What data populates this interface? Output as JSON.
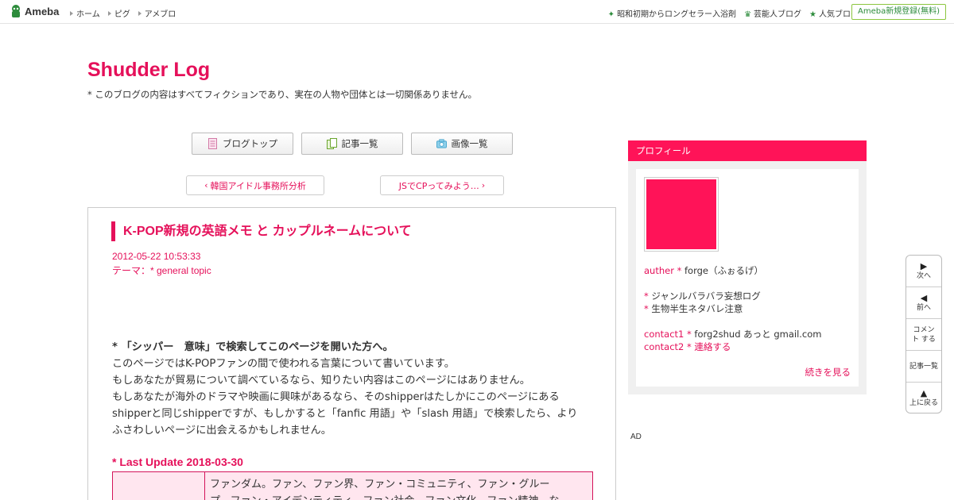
{
  "topbar": {
    "logo_text": "Ameba",
    "nav": [
      "ホーム",
      "ピグ",
      "アメブロ"
    ],
    "right_links": [
      {
        "icon": "sparkle-icon",
        "label": "昭和初期からロングセラー入浴剤"
      },
      {
        "icon": "crown-icon",
        "label": "芸能人ブログ"
      },
      {
        "icon": "star-icon",
        "label": "人気ブログ"
      }
    ],
    "register_label": "Ameba新規登録(無料)"
  },
  "header": {
    "title": "Shudder Log",
    "description": "* このブログの内容はすべてフィクションであり、実在の人物や団体とは一切関係ありません。"
  },
  "blog_nav": {
    "top_label": "ブログトップ",
    "list_label": "記事一覧",
    "images_label": "画像一覧"
  },
  "pager": {
    "prev_label": "韓国アイドル事務所分析",
    "next_label": "JSでCPってみよう…"
  },
  "article": {
    "title": "K-POP新規の英語メモ と カップルネームについて",
    "date": "2012-05-22 10:53:33",
    "theme": "テーマ：* general topic",
    "lead": "* 「シッパー　意味」で検索してこのページを開いた方へ。",
    "lines": [
      "このページではK-POPファンの間で使われる言葉について書いています。",
      "もしあなたが貿易について調べているなら、知りたい内容はこのページにはありません。",
      "もしあなたが海外のドラマや映画に興味があるなら、そのshipperはたしかにこのページにある",
      "shipperと同じshipperですが、もしかすると「fanfic 用語」や「slash 用語」で検索したら、より",
      "ふさわしいページに出会えるかもしれません。"
    ],
    "last_update": "* Last Update 2018-03-30",
    "table_text_1": "ファンダム。ファン、ファン界、ファン・コミュニティ、ファン・グルー",
    "table_text_2": "プ、ファン・アイデンティティ、ファン社会、ファン文化、ファン精神、な"
  },
  "profile": {
    "header": "プロフィール",
    "auther_key": "auther * ",
    "auther_val": "forge（ふぉるげ）",
    "line1_mark": "* ",
    "line1": "ジャンルバラバラ妄想ログ",
    "line2_mark": "* ",
    "line2": "生物半生ネタバレ注意",
    "contact1_key": "contact1 * ",
    "contact1_val": "forg2shud あっと gmail.com",
    "contact2_key": "contact2 * ",
    "contact2_val": "連絡する",
    "more": "続きを見る",
    "avatar_color": "#ff1358"
  },
  "ad_label": "AD",
  "float_nav": [
    {
      "glyph": "▶",
      "label": "次へ"
    },
    {
      "glyph": "◀",
      "label": "前へ"
    },
    {
      "glyph": "",
      "label": "コメント する"
    },
    {
      "glyph": "",
      "label": "記事一覧"
    },
    {
      "glyph": "▲",
      "label": "上に戻る"
    }
  ],
  "colors": {
    "accent": "#e5105a",
    "profile_header": "#ff1358",
    "green": "#2d8c3c"
  }
}
